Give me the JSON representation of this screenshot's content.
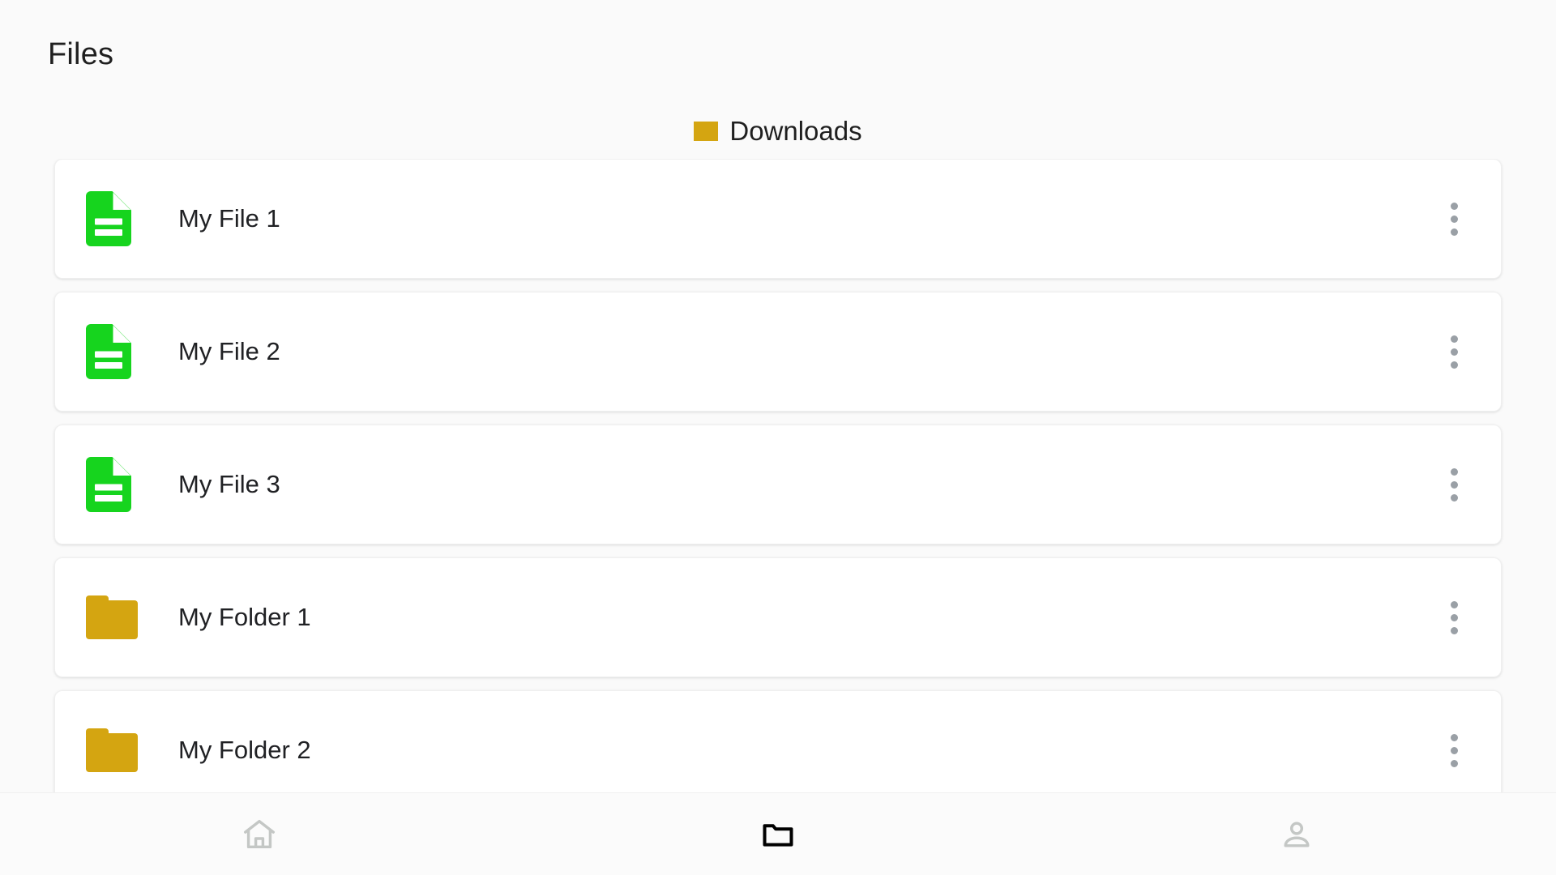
{
  "app": {
    "title": "Files",
    "background_color": "#fafafa"
  },
  "breadcrumb": {
    "icon": "folder-icon",
    "label": "Downloads",
    "icon_color": "#d4a511"
  },
  "colors": {
    "file_icon": "#16d41e",
    "folder_icon": "#d4a511",
    "kebab_dot": "#9aa0a6",
    "nav_inactive": "#c4c7c5",
    "nav_active": "#000000",
    "card_background": "#ffffff",
    "text": "#202124"
  },
  "list": {
    "items": [
      {
        "name": "My File 1",
        "type": "file",
        "icon": "document-icon",
        "menu_icon": "more-vertical-icon"
      },
      {
        "name": "My File 2",
        "type": "file",
        "icon": "document-icon",
        "menu_icon": "more-vertical-icon"
      },
      {
        "name": "My File 3",
        "type": "file",
        "icon": "document-icon",
        "menu_icon": "more-vertical-icon"
      },
      {
        "name": "My Folder 1",
        "type": "folder",
        "icon": "folder-icon",
        "menu_icon": "more-vertical-icon"
      },
      {
        "name": "My Folder 2",
        "type": "folder",
        "icon": "folder-icon",
        "menu_icon": "more-vertical-icon"
      }
    ]
  },
  "bottom_nav": {
    "items": [
      {
        "icon": "home-icon",
        "label": "Home",
        "active": false
      },
      {
        "icon": "folder-icon",
        "label": "Files",
        "active": true
      },
      {
        "icon": "person-icon",
        "label": "Account",
        "active": false
      }
    ]
  }
}
